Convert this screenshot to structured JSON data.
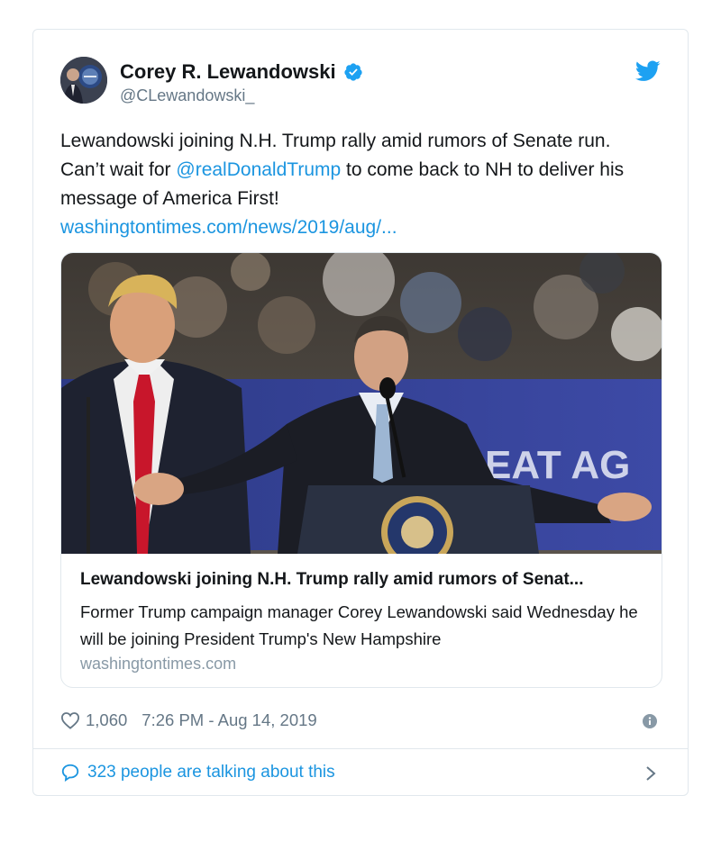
{
  "author": {
    "name": "Corey R. Lewandowski",
    "handle": "@CLewandowski_"
  },
  "tweet": {
    "text_before": "Lewandowski joining N.H. Trump rally amid rumors of Senate run. Can’t wait for ",
    "mention": "@realDonaldTrump",
    "text_after": " to come back to NH to deliver his message of America First!",
    "link": "washingtontimes.com/news/2019/aug/..."
  },
  "link_card": {
    "title": "Lewandowski joining N.H. Trump rally amid rumors of Senat...",
    "description": "Former Trump campaign manager Corey Lewandowski said Wednesday he will be joining President Trump's New Hampshire",
    "domain": "washingtontimes.com",
    "image_sign_text": "EAT AG"
  },
  "meta": {
    "likes": "1,060",
    "timestamp": "7:26 PM - Aug 14, 2019"
  },
  "footer": {
    "talking": "323 people are talking about this"
  },
  "icons": {
    "verified": "verified-badge-icon",
    "twitter": "twitter-bird-icon",
    "like": "heart-icon",
    "info": "info-icon",
    "reply": "speech-bubble-icon",
    "more": "chevron-right-icon"
  },
  "colors": {
    "accent": "#1da1f2",
    "link": "#1b95e0",
    "muted": "#657786",
    "border": "#e1e8ed"
  }
}
